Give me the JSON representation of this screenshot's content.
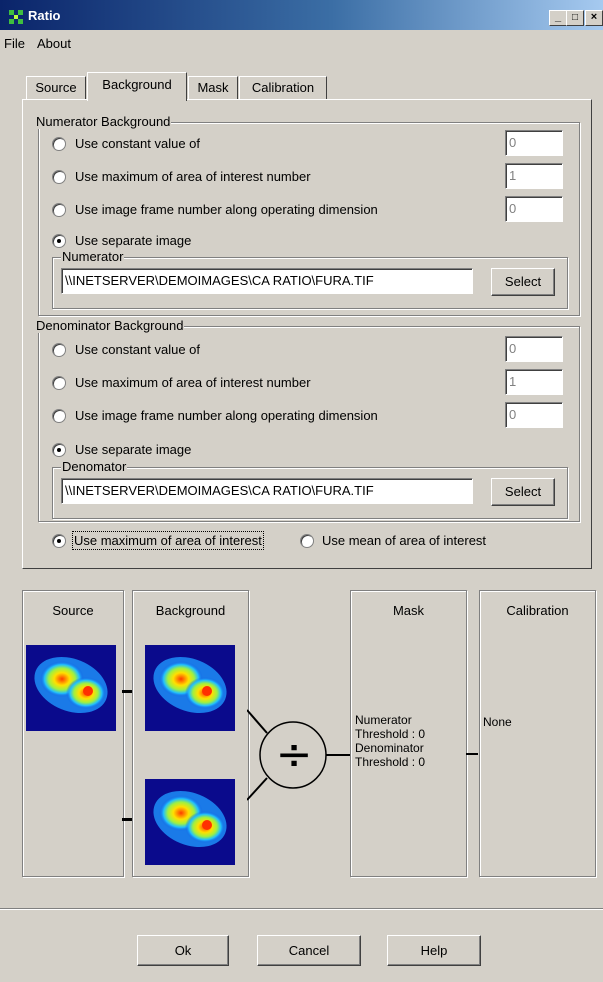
{
  "window": {
    "title": "Ratio",
    "controls": [
      "_",
      "□",
      "×"
    ]
  },
  "menu": {
    "items": [
      "File",
      "About"
    ]
  },
  "tabs": [
    {
      "label": "Source",
      "active": false
    },
    {
      "label": "Background",
      "active": true
    },
    {
      "label": "Mask",
      "active": false
    },
    {
      "label": "Calibration",
      "active": false
    }
  ],
  "numerator_bg": {
    "legend": "Numerator Background",
    "options": [
      {
        "label": "Use constant value of",
        "value": "0",
        "selected": false
      },
      {
        "label": "Use maximum of area of interest number",
        "value": "1",
        "selected": false
      },
      {
        "label": "Use image frame number along operating dimension",
        "value": "0",
        "selected": false
      },
      {
        "label": "Use separate image",
        "selected": true
      }
    ],
    "image_legend": "Numerator",
    "path": "\\\\INETSERVER\\DEMOIMAGES\\CA RATIO\\FURA.TIF",
    "select_label": "Select"
  },
  "denominator_bg": {
    "legend": "Denominator Background",
    "options": [
      {
        "label": "Use constant value of",
        "value": "0",
        "selected": false
      },
      {
        "label": "Use maximum of area of interest number",
        "value": "1",
        "selected": false
      },
      {
        "label": "Use image frame number along operating dimension",
        "value": "0",
        "selected": false
      },
      {
        "label": "Use separate image",
        "selected": true
      }
    ],
    "image_legend": "Denomator",
    "path": "\\\\INETSERVER\\DEMOIMAGES\\CA RATIO\\FURA.TIF",
    "select_label": "Select"
  },
  "aoi_mode": {
    "max_label": "Use maximum of area of interest",
    "mean_label": "Use mean of area of interest",
    "selected": "max"
  },
  "pipeline": {
    "source_title": "Source",
    "background_title": "Background",
    "mask_title": "Mask",
    "mask_lines": [
      "Numerator",
      "Threshold : 0",
      "Denominator",
      "Threshold : 0"
    ],
    "calibration_title": "Calibration",
    "calibration_value": "None",
    "operator_symbol": "÷"
  },
  "buttons": {
    "ok": "Ok",
    "cancel": "Cancel",
    "help": "Help"
  },
  "colors": {
    "title_start": "#0a246a",
    "title_end": "#a6caf0",
    "face": "#d4d0c8",
    "thumb_bg": "#0a0a8c"
  }
}
